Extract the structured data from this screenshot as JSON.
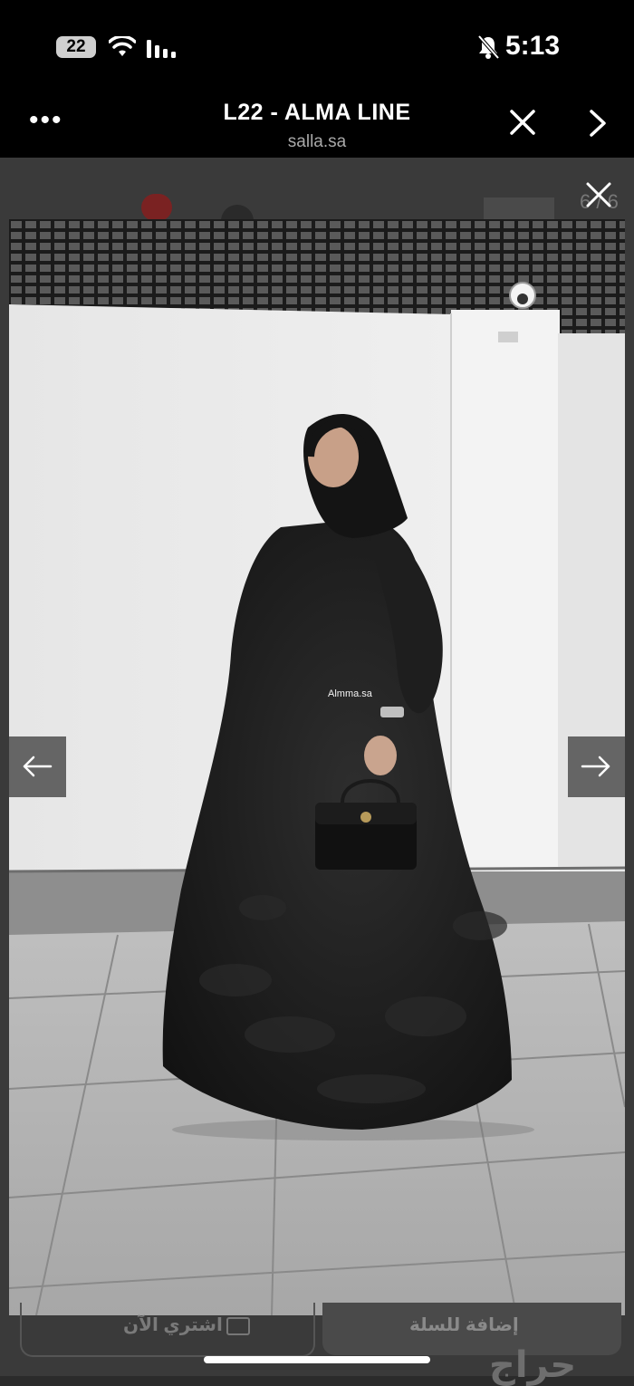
{
  "status_bar": {
    "battery_level": "22",
    "time": "5:13",
    "icons": [
      "wifi-icon",
      "cellular-signal-icon",
      "bell-slash-icon"
    ]
  },
  "browser": {
    "title": "L22 - ALMA LINE",
    "domain": "salla.sa",
    "icons": [
      "more-dots-icon",
      "close-icon",
      "chevron-right-icon"
    ]
  },
  "lightbox": {
    "counter": "6 / 6",
    "watermark": "Almma.sa",
    "prev_icon": "arrow-left-icon",
    "next_icon": "arrow-right-icon",
    "close_icon": "close-icon"
  },
  "actions": {
    "buy_now": "اشتري الآن",
    "add_to_cart": "إضافة للسلة"
  },
  "brand": {
    "haraj": "حراج"
  },
  "colors": {
    "bar_background": "#000000",
    "overlay": "#3a3a3a",
    "nav_button": "#5a5a5a"
  }
}
